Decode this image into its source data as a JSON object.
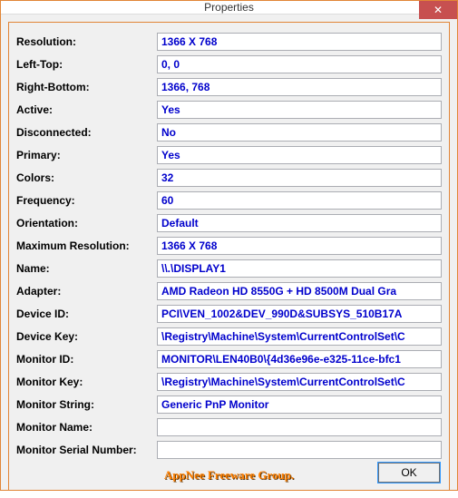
{
  "window": {
    "title": "Properties",
    "close_label": "✕"
  },
  "properties": [
    {
      "label": "Resolution:",
      "value": "1366 X 768"
    },
    {
      "label": "Left-Top:",
      "value": "0, 0"
    },
    {
      "label": "Right-Bottom:",
      "value": "1366, 768"
    },
    {
      "label": "Active:",
      "value": "Yes"
    },
    {
      "label": "Disconnected:",
      "value": "No"
    },
    {
      "label": "Primary:",
      "value": "Yes"
    },
    {
      "label": "Colors:",
      "value": "32"
    },
    {
      "label": "Frequency:",
      "value": "60"
    },
    {
      "label": "Orientation:",
      "value": "Default"
    },
    {
      "label": "Maximum Resolution:",
      "value": "1366 X 768"
    },
    {
      "label": "Name:",
      "value": "\\\\.\\DISPLAY1"
    },
    {
      "label": "Adapter:",
      "value": "AMD Radeon HD 8550G + HD 8500M Dual Gra"
    },
    {
      "label": "Device ID:",
      "value": "PCI\\VEN_1002&DEV_990D&SUBSYS_510B17A"
    },
    {
      "label": "Device Key:",
      "value": "\\Registry\\Machine\\System\\CurrentControlSet\\C"
    },
    {
      "label": "Monitor ID:",
      "value": "MONITOR\\LEN40B0\\{4d36e96e-e325-11ce-bfc1"
    },
    {
      "label": "Monitor Key:",
      "value": "\\Registry\\Machine\\System\\CurrentControlSet\\C"
    },
    {
      "label": "Monitor String:",
      "value": "Generic PnP Monitor"
    },
    {
      "label": "Monitor Name:",
      "value": ""
    },
    {
      "label": "Monitor Serial Number:",
      "value": ""
    }
  ],
  "footer": {
    "group_text": "AppNee Freeware Group.",
    "ok_label": "OK"
  }
}
